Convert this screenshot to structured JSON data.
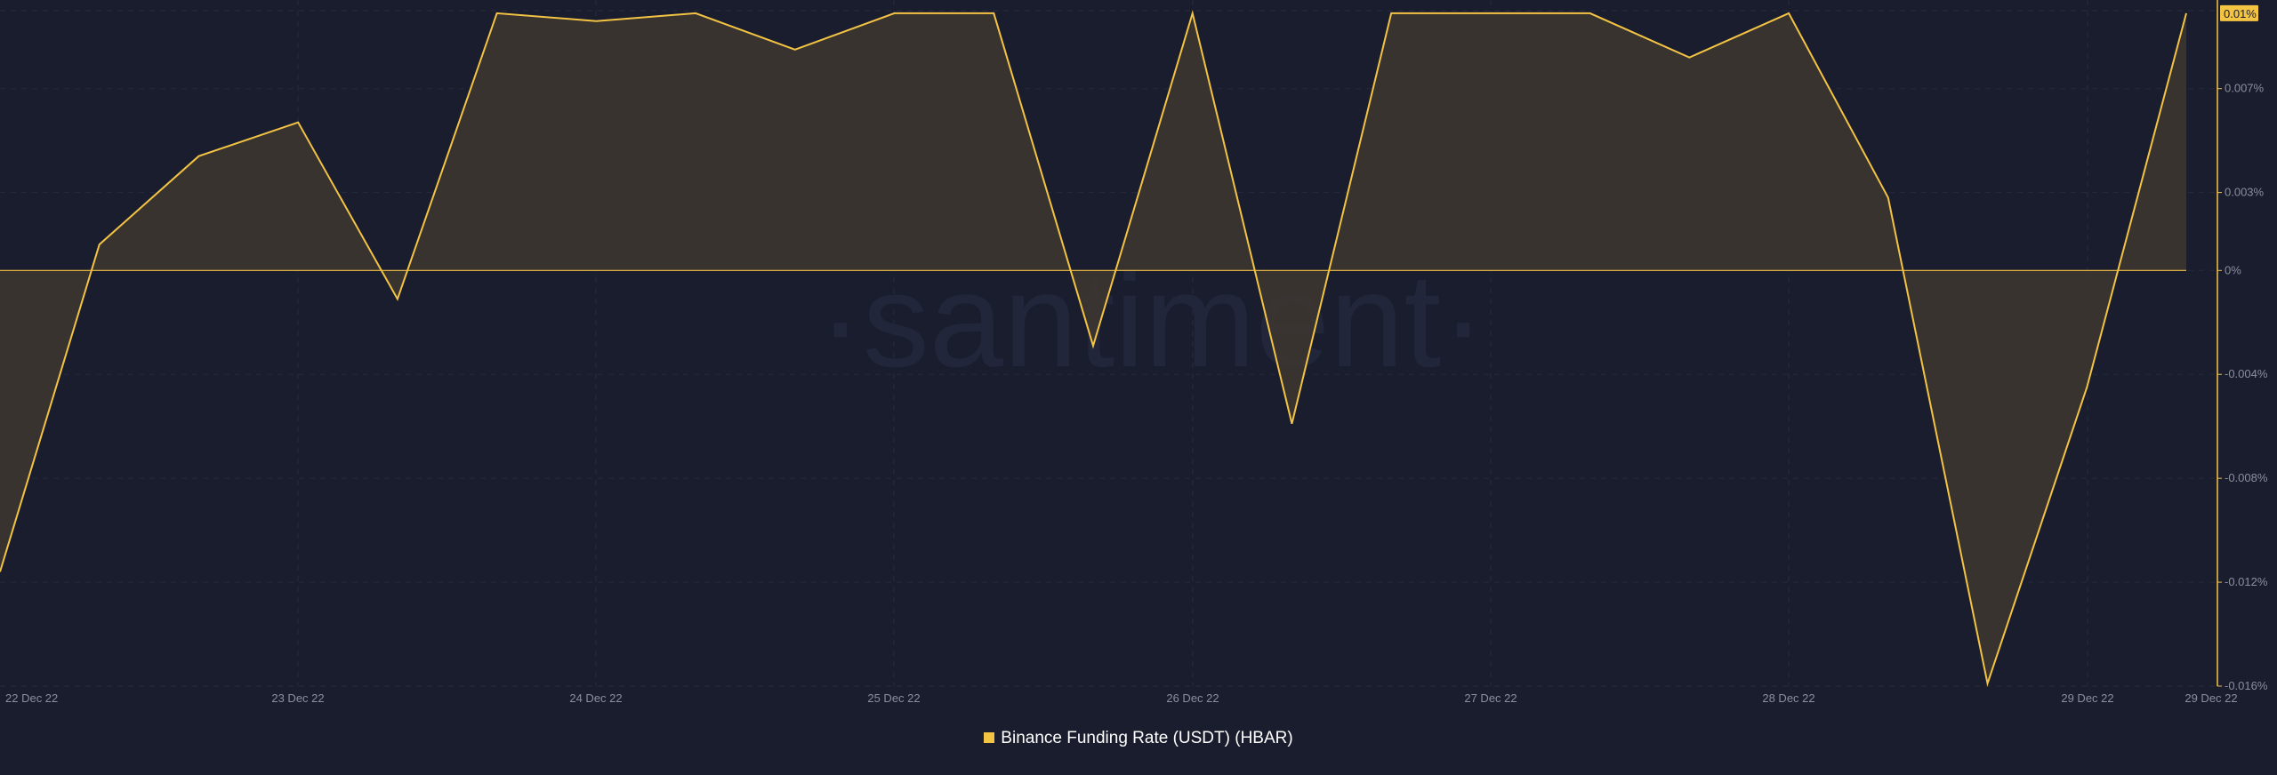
{
  "chart_data": {
    "type": "area",
    "watermark": "·santiment·",
    "colors": {
      "background": "#1a1d2e",
      "line": "#f3c344",
      "fill": "#3b3530",
      "grid": "#262a3c",
      "axis_text": "#8a8f9e",
      "highlight_text": "#1a1d2e"
    },
    "x_tick_labels": [
      "22 Dec 22",
      "23 Dec 22",
      "24 Dec 22",
      "25 Dec 22",
      "26 Dec 22",
      "27 Dec 22",
      "28 Dec 22",
      "29 Dec 22",
      "29 Dec 22"
    ],
    "y_tick_labels": [
      "0.007%",
      "0.003%",
      "0%",
      "-0.004%",
      "-0.008%",
      "-0.012%",
      "-0.016%"
    ],
    "y_ticks": [
      0.007,
      0.003,
      0,
      -0.004,
      -0.008,
      -0.012,
      -0.016
    ],
    "ylim": [
      -0.016,
      0.01
    ],
    "current_value_label": "0.01%",
    "series": [
      {
        "name": "Binance Funding Rate (USDT) (HBAR)",
        "values": [
          -0.0116,
          0.001,
          0.0044,
          0.0057,
          -0.0011,
          0.0099,
          0.0096,
          0.0099,
          0.0085,
          0.0099,
          0.0099,
          -0.0029,
          0.0099,
          -0.0059,
          0.0099,
          0.0099,
          0.0099,
          0.0082,
          0.0099,
          0.0028,
          -0.0159,
          -0.0045,
          0.0099
        ]
      }
    ]
  },
  "legend": {
    "label": "Binance Funding Rate (USDT) (HBAR)",
    "color": "#f3c344"
  }
}
